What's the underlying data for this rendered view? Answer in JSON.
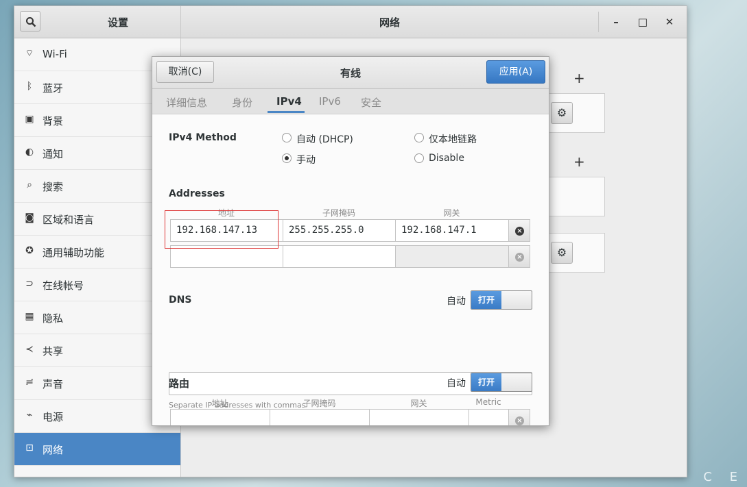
{
  "window": {
    "sidebar_title": "设置",
    "title": "网络",
    "controls": {
      "minimize": "–",
      "maximize": "□",
      "close": "✕"
    }
  },
  "sidebar": {
    "items": [
      {
        "label": "Wi-Fi",
        "icon": "wifi-icon",
        "glyph": "⌔"
      },
      {
        "label": "蓝牙",
        "icon": "bluetooth-icon",
        "glyph": "ᛒ"
      },
      {
        "label": "背景",
        "icon": "background-icon",
        "glyph": "▣"
      },
      {
        "label": "通知",
        "icon": "notifications-icon",
        "glyph": "◐"
      },
      {
        "label": "搜索",
        "icon": "search-icon",
        "glyph": "⌕"
      },
      {
        "label": "区域和语言",
        "icon": "camera-icon",
        "glyph": "◙"
      },
      {
        "label": "通用辅助功能",
        "icon": "accessibility-icon",
        "glyph": "✪"
      },
      {
        "label": "在线帐号",
        "icon": "online-accounts-icon",
        "glyph": "⊃"
      },
      {
        "label": "隐私",
        "icon": "privacy-icon",
        "glyph": "▦"
      },
      {
        "label": "共享",
        "icon": "share-icon",
        "glyph": "≺"
      },
      {
        "label": "声音",
        "icon": "sound-icon",
        "glyph": "≓"
      },
      {
        "label": "电源",
        "icon": "power-icon",
        "glyph": "⌁"
      },
      {
        "label": "网络",
        "icon": "network-icon",
        "glyph": "⊡",
        "active": true
      }
    ]
  },
  "main": {
    "plus": "+",
    "gear": "⚙"
  },
  "dialog": {
    "cancel_label": "取消(C)",
    "title": "有线",
    "apply_label": "应用(A)",
    "tabs": [
      "详细信息",
      "身份",
      "IPv4",
      "IPv6",
      "安全"
    ],
    "active_tab": "IPv4",
    "ipv4_method_label": "IPv4 Method",
    "methods": [
      {
        "label": "自动 (DHCP)",
        "selected": false
      },
      {
        "label": "仅本地链路",
        "selected": false
      },
      {
        "label": "手动",
        "selected": true
      },
      {
        "label": "Disable",
        "selected": false
      }
    ],
    "addresses_label": "Addresses",
    "address_columns": [
      "地址",
      "子网掩码",
      "网关"
    ],
    "address_rows": [
      {
        "address": "192.168.147.13",
        "netmask": "255.255.255.0",
        "gateway": "192.168.147.1"
      },
      {
        "address": "",
        "netmask": "",
        "gateway": ""
      }
    ],
    "dns_label": "DNS",
    "dns_auto_label": "自动",
    "dns_switch_label": "打开",
    "dns_value": "",
    "dns_hint": "Separate IP addresses with commas",
    "routes_label": "路由",
    "routes_auto_label": "自动",
    "routes_switch_label": "打开",
    "route_columns": [
      "地址",
      "子网掩码",
      "网关",
      "Metric"
    ]
  },
  "desktop_corner": "C E"
}
